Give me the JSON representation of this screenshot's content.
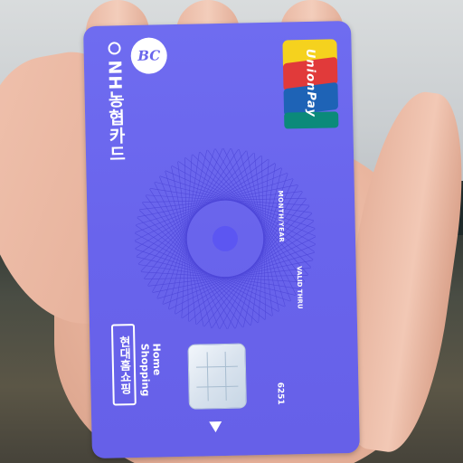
{
  "card": {
    "issuer": "NH농협카드",
    "network_logo": "bc-logo",
    "network_text": "BC",
    "payment_network": "UnionPay",
    "valid_label": "VALID THRU",
    "expiry_placeholder": "MONTH/YEAR",
    "sponsor_korean": "현대홈쇼핑",
    "sponsor_english": "Home Shopping",
    "card_number_fragment": "6251",
    "colors": {
      "card_primary": "#6a66ec",
      "unionpay_red": "#e13a3a",
      "unionpay_blue": "#1e63b6",
      "unionpay_green": "#0b8a7a"
    }
  }
}
